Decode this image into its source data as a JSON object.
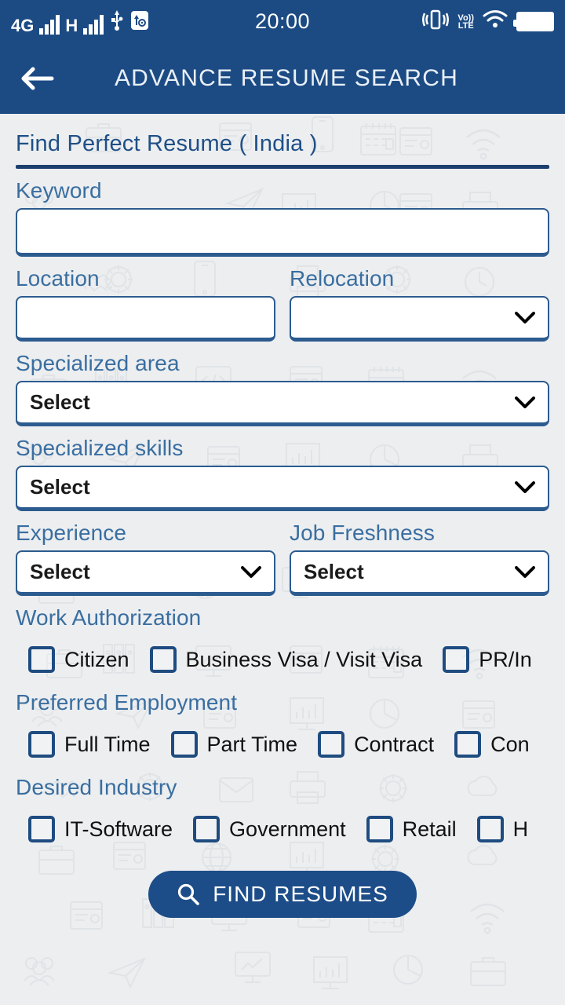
{
  "status_bar": {
    "network_4g": "4G",
    "network_h": "H",
    "time": "20:00",
    "volte": "VoLTE",
    "icons": [
      "signal-bars-icon",
      "signal-bars-icon",
      "usb-icon",
      "usb-debug-icon",
      "vibrate-icon",
      "volte-icon",
      "wifi-icon",
      "battery-icon"
    ]
  },
  "app_bar": {
    "back_label": "back-arrow",
    "title": "ADVANCE RESUME SEARCH"
  },
  "form": {
    "heading": "Find Perfect Resume ( India )",
    "keyword": {
      "label": "Keyword",
      "value": "",
      "placeholder": ""
    },
    "location": {
      "label": "Location",
      "value": "",
      "placeholder": ""
    },
    "relocation": {
      "label": "Relocation",
      "value": ""
    },
    "specialized_area": {
      "label": "Specialized area",
      "value": "Select"
    },
    "specialized_skills": {
      "label": "Specialized skills",
      "value": "Select"
    },
    "experience": {
      "label": "Experience",
      "value": "Select"
    },
    "job_freshness": {
      "label": "Job Freshness",
      "value": "Select"
    },
    "work_authorization": {
      "label": "Work Authorization",
      "options": [
        {
          "label": "Citizen",
          "checked": false
        },
        {
          "label": "Business Visa / Visit Visa",
          "checked": false
        },
        {
          "label": "PR/In",
          "checked": false
        }
      ]
    },
    "preferred_employment": {
      "label": "Preferred Employment",
      "options": [
        {
          "label": "Full Time",
          "checked": false
        },
        {
          "label": "Part Time",
          "checked": false
        },
        {
          "label": "Contract",
          "checked": false
        },
        {
          "label": "Con",
          "checked": false
        }
      ]
    },
    "desired_industry": {
      "label": "Desired Industry",
      "options": [
        {
          "label": "IT-Software",
          "checked": false
        },
        {
          "label": "Government",
          "checked": false
        },
        {
          "label": "Retail",
          "checked": false
        },
        {
          "label": "H",
          "checked": false
        }
      ]
    },
    "submit": {
      "label": "FIND RESUMES",
      "icon": "search-icon"
    }
  },
  "colors": {
    "header_blue": "#1c4b84",
    "accent_blue": "#1d4d88",
    "label_blue": "#3a6ea0",
    "heading_blue": "#1f4f86",
    "page_bg": "#eceef0"
  }
}
